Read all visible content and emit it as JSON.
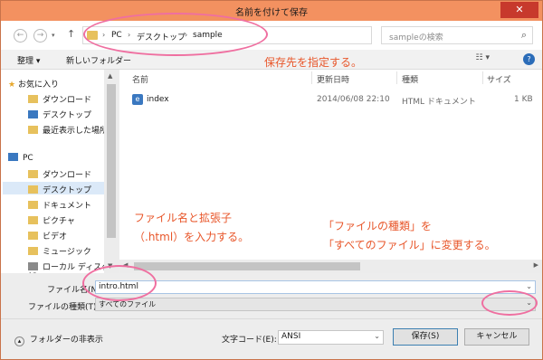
{
  "window": {
    "title": "名前を付けて保存",
    "close_glyph": "✕"
  },
  "nav_buttons": {
    "back": "←",
    "forward": "→",
    "up": "↑"
  },
  "breadcrumb": [
    "PC",
    "デスクトップ",
    "sample"
  ],
  "breadcrumb_sep": "›",
  "search": {
    "placeholder": "sampleの検索",
    "icon": "search-icon"
  },
  "toolbar": {
    "organize": "整理 ▾",
    "new_folder": "新しいフォルダー",
    "view": "☷ ▾",
    "help": "?"
  },
  "sidebar": {
    "favorites": "お気に入り",
    "fav_items": [
      "ダウンロード",
      "デスクトップ",
      "最近表示した場所"
    ],
    "pc": "PC",
    "pc_items": [
      "ダウンロード",
      "デスクトップ",
      "ドキュメント",
      "ピクチャ",
      "ビデオ",
      "ミュージック",
      "ローカル ディスク (C"
    ],
    "selected": "デスクトップ"
  },
  "columns": [
    "名前",
    "更新日時",
    "種類",
    "サイズ"
  ],
  "files": [
    {
      "name": "index",
      "modified": "2014/06/08 22:10",
      "type": "HTML ドキュメント",
      "size": "1 KB"
    }
  ],
  "form": {
    "filename_label": "ファイル名(N):",
    "filename_value": "intro.html",
    "filetype_label": "ファイルの種類(T):",
    "filetype_value": "すべてのファイル",
    "encoding_label": "文字コード(E):",
    "encoding_value": "ANSI",
    "save": "保存(S)",
    "cancel": "キャンセル",
    "hide_folders": "フォルダーの非表示"
  },
  "annotations": {
    "save_location": "保存先を指定する。",
    "filename_line1": "ファイル名と拡張子",
    "filename_line2": "（.html）を入力する。",
    "type_line1": "「ファイルの種類」を",
    "type_line2": "「すべてのファイル」に変更する。"
  },
  "colors": {
    "titlebar": "#f39160",
    "close": "#c7392c",
    "annotation": "#e8562a",
    "ring": "#ef6fa0"
  }
}
